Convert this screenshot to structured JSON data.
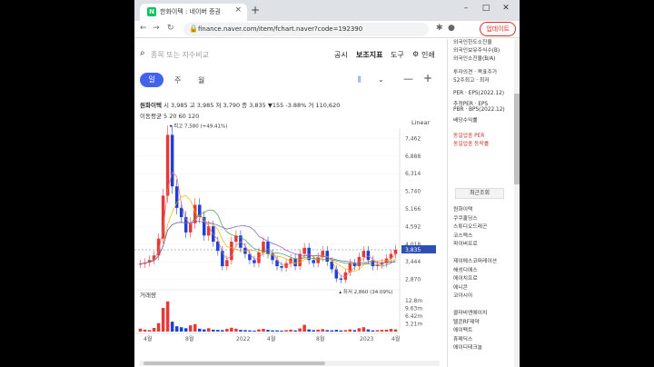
{
  "browser": {
    "tab_title": "한화이텍 : 네이버 증권",
    "tab_favicon": "N",
    "new_tab": "+",
    "url": "finance.naver.com/item/fchart.naver?code=192390",
    "update_label": "업데이트",
    "controls": [
      "–",
      "□",
      "✕"
    ]
  },
  "chart_ui": {
    "search_placeholder": "종목 또는 지수비교",
    "menu": [
      "공시",
      "보조지표",
      "도구",
      "인쇄"
    ],
    "periods": [
      "일",
      "주",
      "월"
    ],
    "stock_name": "원화이텍",
    "quote_text": "시 3,985  고 3,985  저 3,790  종 3,835 ▼155 -3.88%  거 110,620",
    "ma_text": "이동평균  5  20  60  120",
    "scale_label": "Linear",
    "volume_label": "거래량",
    "high_annotation": "최고 7,580 (+49.41%)",
    "low_annotation": "최저 2,860 (34.09%)",
    "last_price_tag": "3,835",
    "last_price_tag2": "4,018"
  },
  "chart_data": {
    "type": "candlestick",
    "price_axis_ticks": [
      "7,462",
      "6,888",
      "6,314",
      "5,740",
      "5,166",
      "4,592",
      "4,018",
      "3,444",
      "2,870"
    ],
    "volume_axis_ticks": [
      "12.8m",
      "9.63m",
      "6.42m",
      "3.21m"
    ],
    "x_tick_labels": [
      "4월",
      "8월",
      "2022",
      "4월",
      "8월",
      "2023",
      "4월"
    ],
    "close_series": [
      3380,
      3420,
      3500,
      3650,
      4200,
      5600,
      7580,
      5900,
      5200,
      4900,
      4400,
      4700,
      5300,
      4900,
      4300,
      4600,
      4100,
      3800,
      3300,
      3500,
      4100,
      4300,
      3900,
      3700,
      3500,
      3400,
      3750,
      4100,
      3700,
      3500,
      3300,
      3250,
      3400,
      3550,
      3300,
      3700,
      3900,
      3500,
      3400,
      3600,
      3800,
      3450,
      3200,
      2900,
      2860,
      3100,
      3400,
      3300,
      3600,
      3800,
      3500,
      3300,
      3350,
      3400,
      3550,
      3700,
      3835
    ],
    "volume_series": [
      1.2,
      0.8,
      0.6,
      1.5,
      3.5,
      9.8,
      12.5,
      4.1,
      2.2,
      1.8,
      1.4,
      2.6,
      3.1,
      1.2,
      0.9,
      1.4,
      0.8,
      0.7,
      0.6,
      1.1,
      1.6,
      1.2,
      0.7,
      0.6,
      0.5,
      0.4,
      0.9,
      1.1,
      0.7,
      0.5,
      0.5,
      0.4,
      0.6,
      0.8,
      0.5,
      1.3,
      2.8,
      0.9,
      0.6,
      0.8,
      1.0,
      0.6,
      0.5,
      0.7,
      0.5,
      0.6,
      0.9,
      0.6,
      1.4,
      1.8,
      0.9,
      0.5,
      0.6,
      0.7,
      0.8,
      1.1,
      0.9
    ],
    "ylim": [
      2870,
      7462
    ],
    "colors": {
      "up": "#e53935",
      "down": "#1e40d8",
      "ma5": "#e57373",
      "ma20": "#f4b400",
      "ma60": "#43a047",
      "ma120": "#7e57c2"
    }
  },
  "right_panel": {
    "items_top": [
      "외국인한도소진율",
      "외국인보유주식수(B)",
      "외국인소진율(B/A)"
    ],
    "items_mid": [
      "투자의견 · 목표주가",
      "52주최고 · 최저"
    ],
    "items_per": [
      "PER · EPS(2022.12)",
      "추정PER · EPS",
      "PBR · BPS(2022.12)",
      "배당수익률"
    ],
    "items_same": [
      "동일업종 PER",
      "동일업종 등락률"
    ],
    "recent_label": "최근조회",
    "recent_list": [
      "원화이텍",
      "쿠쿠홀딩스",
      "스튜디오드래곤",
      "코스맥스",
      "파이버프로",
      "",
      "제이에스코퍼레이션",
      "해성디에스",
      "에이치프로",
      "에니콘",
      "코아시아"
    ],
    "recent_list2": [
      "콜마비앤에이치",
      "텔콘RF제약",
      "에이팩트",
      "휴메딕스",
      "에이디테크놀"
    ]
  }
}
